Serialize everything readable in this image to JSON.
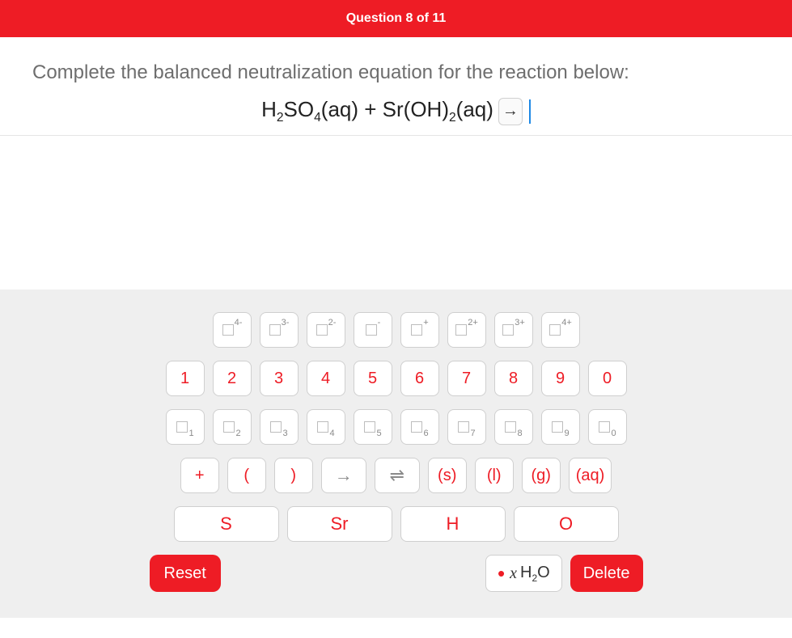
{
  "header": {
    "title": "Question 8 of 11"
  },
  "prompt": {
    "text": "Complete the balanced neutralization equation for the reaction below:",
    "equation_html": "H<sub>2</sub>SO<sub>4</sub>(aq) + Sr(OH)<sub>2</sub>(aq)",
    "arrow": "→"
  },
  "keypad": {
    "charge_row": [
      {
        "sup": "4-"
      },
      {
        "sup": "3-"
      },
      {
        "sup": "2-"
      },
      {
        "sup": "-"
      },
      {
        "sup": "+"
      },
      {
        "sup": "2+"
      },
      {
        "sup": "3+"
      },
      {
        "sup": "4+"
      }
    ],
    "digit_row": [
      "1",
      "2",
      "3",
      "4",
      "5",
      "6",
      "7",
      "8",
      "9",
      "0"
    ],
    "subscript_row": [
      {
        "sub": "1"
      },
      {
        "sub": "2"
      },
      {
        "sub": "3"
      },
      {
        "sub": "4"
      },
      {
        "sub": "5"
      },
      {
        "sub": "6"
      },
      {
        "sub": "7"
      },
      {
        "sub": "8"
      },
      {
        "sub": "9"
      },
      {
        "sub": "0"
      }
    ],
    "operator_row": [
      {
        "label": "+",
        "kind": "op"
      },
      {
        "label": "(",
        "kind": "op"
      },
      {
        "label": ")",
        "kind": "op"
      },
      {
        "label": "→",
        "kind": "arrow"
      },
      {
        "label": "⇌",
        "kind": "arrow"
      },
      {
        "label": "(s)",
        "kind": "op"
      },
      {
        "label": "(l)",
        "kind": "op"
      },
      {
        "label": "(g)",
        "kind": "op"
      },
      {
        "label": "(aq)",
        "kind": "op"
      }
    ],
    "element_row": [
      "S",
      "Sr",
      "H",
      "O"
    ],
    "reset_label": "Reset",
    "water_label": "H₂O",
    "water_prefix_dot": "•",
    "water_prefix_x": "x",
    "delete_label": "Delete"
  }
}
